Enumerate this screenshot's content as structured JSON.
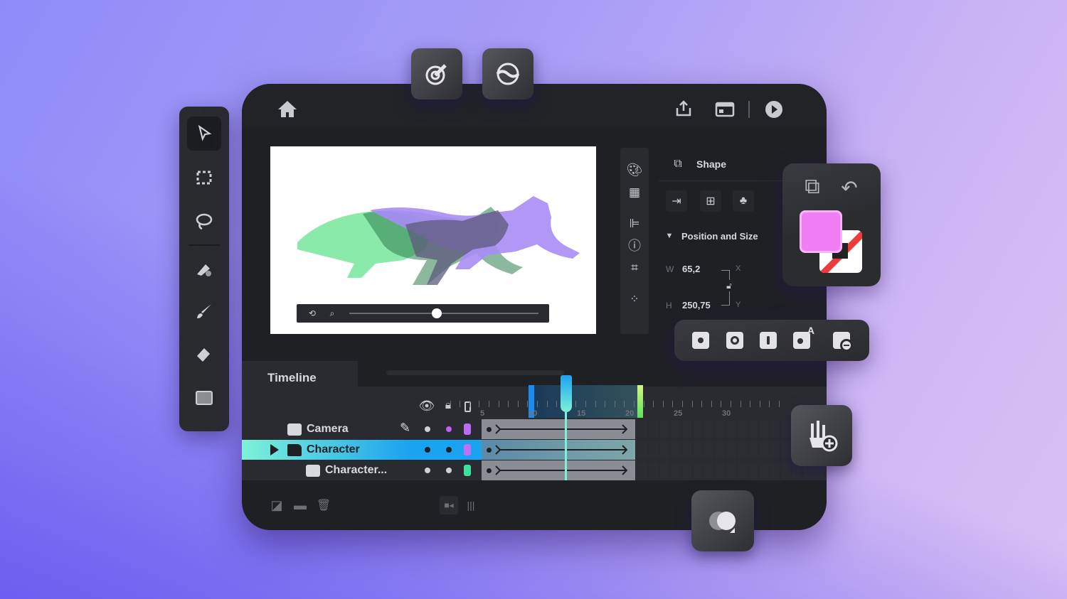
{
  "colors": {
    "accent_blue": "#1aa3f0",
    "accent_cyan": "#7ef2d8",
    "accent_green": "#a8f060",
    "fill_color": "#f27ef5",
    "cat_green": "#7de8a0",
    "cat_purple": "#a98cf5",
    "cat_gray": "#707282"
  },
  "toolbar": {
    "tools": [
      "select-arrow-icon",
      "transform-icon",
      "lasso-icon",
      "paint-bucket-icon",
      "brush-icon",
      "eraser-icon",
      "rectangle-icon"
    ]
  },
  "floating_top": [
    "brush-target-icon",
    "smooth-stroke-icon"
  ],
  "header": {
    "icons": [
      "home-icon",
      "share-icon",
      "window-icon",
      "play-icon"
    ]
  },
  "panel": {
    "section": "Shape",
    "group": "Position and Size",
    "w_label": "W",
    "w_value": "65,2",
    "h_label": "H",
    "h_value": "250,75",
    "x_label": "X",
    "y_label": "Y"
  },
  "timeline": {
    "title": "Timeline",
    "ruler_labels": [
      "5",
      "10",
      "15",
      "20",
      "25",
      "30"
    ],
    "range_start_frame": 5,
    "playhead_frame": 13,
    "range_end_frame": 16,
    "layers": [
      {
        "name": "Camera",
        "type": "camera",
        "chip": "#b86cf2",
        "selected": false
      },
      {
        "name": "Character",
        "type": "folder",
        "chip": "#c070f0",
        "selected": true
      },
      {
        "name": "Character...",
        "type": "layer",
        "chip": "#3ee0a0",
        "selected": false
      }
    ]
  }
}
